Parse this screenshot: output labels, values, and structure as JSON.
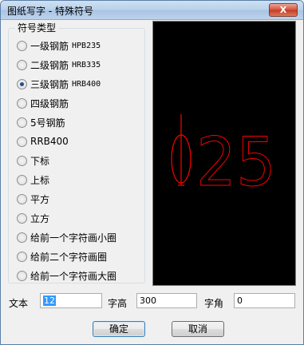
{
  "window": {
    "title": "图纸写字 - 特殊符号",
    "close_label": "X"
  },
  "symbol_type": {
    "legend": "符号类型",
    "options": [
      {
        "label": "一级钢筋",
        "code": "HPB235",
        "checked": false
      },
      {
        "label": "二级钢筋",
        "code": "HRB335",
        "checked": false
      },
      {
        "label": "三级钢筋",
        "code": "HRB400",
        "checked": true
      },
      {
        "label": "四级钢筋",
        "code": "",
        "checked": false
      },
      {
        "label": "5号钢筋",
        "code": "",
        "checked": false
      },
      {
        "label": "RRB400",
        "code": "",
        "checked": false
      },
      {
        "label": "下标",
        "code": "",
        "checked": false
      },
      {
        "label": "上标",
        "code": "",
        "checked": false
      },
      {
        "label": "平方",
        "code": "",
        "checked": false
      },
      {
        "label": "立方",
        "code": "",
        "checked": false
      },
      {
        "label": "给前一个字符画小圈",
        "code": "",
        "checked": false
      },
      {
        "label": "给前二个字符画圈",
        "code": "",
        "checked": false
      },
      {
        "label": "给前一个字符画大圈",
        "code": "",
        "checked": false
      }
    ]
  },
  "preview": {
    "text": "25",
    "color": "#ff0000",
    "background": "#000000"
  },
  "fields": {
    "text_label": "文本",
    "text_value": "12",
    "height_label": "字高",
    "height_value": "300",
    "angle_label": "字角",
    "angle_value": "0"
  },
  "buttons": {
    "ok": "确定",
    "cancel": "取消"
  }
}
